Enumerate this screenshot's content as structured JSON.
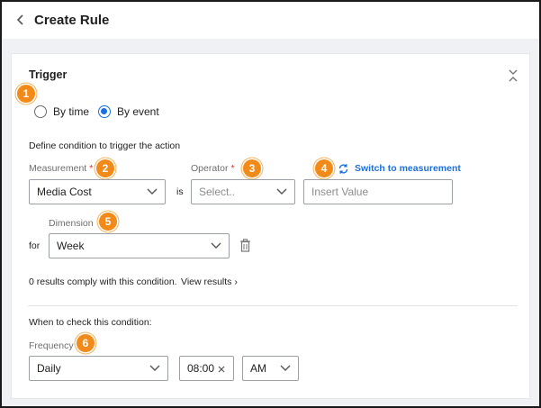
{
  "header": {
    "title": "Create Rule"
  },
  "trigger": {
    "title": "Trigger",
    "radio_options": [
      {
        "label": "By time",
        "selected": false
      },
      {
        "label": "By event",
        "selected": true
      }
    ],
    "define_text": "Define condition to trigger the action",
    "measurement": {
      "label": "Measurement",
      "value": "Media Cost"
    },
    "is_text": "is",
    "operator": {
      "label": "Operator",
      "placeholder": "Select.."
    },
    "value_input": {
      "placeholder": "Insert Value"
    },
    "switch_link": "Switch to measurement",
    "dimension": {
      "label": "Dimension",
      "value": "Week"
    },
    "for_text": "for",
    "results_text": "0 results comply with this condition.",
    "view_results": "View results ›",
    "when_text": "When to check this condition:",
    "frequency": {
      "label": "Frequency",
      "value": "Daily"
    },
    "time": {
      "value": "08:00"
    },
    "ampm": {
      "value": "AM"
    }
  },
  "callouts": [
    "1",
    "2",
    "3",
    "4",
    "5",
    "6"
  ],
  "colors": {
    "accent": "#1a6fe0",
    "callout": "#f28a1a",
    "required": "#d3332f"
  }
}
